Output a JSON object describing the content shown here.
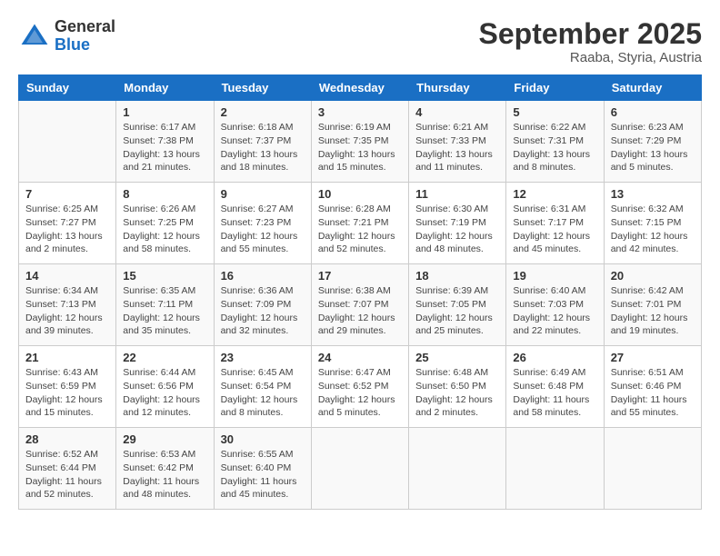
{
  "logo": {
    "general": "General",
    "blue": "Blue"
  },
  "title": {
    "month": "September 2025",
    "location": "Raaba, Styria, Austria"
  },
  "days_of_week": [
    "Sunday",
    "Monday",
    "Tuesday",
    "Wednesday",
    "Thursday",
    "Friday",
    "Saturday"
  ],
  "weeks": [
    [
      {
        "day": "",
        "info": ""
      },
      {
        "day": "1",
        "info": "Sunrise: 6:17 AM\nSunset: 7:38 PM\nDaylight: 13 hours\nand 21 minutes."
      },
      {
        "day": "2",
        "info": "Sunrise: 6:18 AM\nSunset: 7:37 PM\nDaylight: 13 hours\nand 18 minutes."
      },
      {
        "day": "3",
        "info": "Sunrise: 6:19 AM\nSunset: 7:35 PM\nDaylight: 13 hours\nand 15 minutes."
      },
      {
        "day": "4",
        "info": "Sunrise: 6:21 AM\nSunset: 7:33 PM\nDaylight: 13 hours\nand 11 minutes."
      },
      {
        "day": "5",
        "info": "Sunrise: 6:22 AM\nSunset: 7:31 PM\nDaylight: 13 hours\nand 8 minutes."
      },
      {
        "day": "6",
        "info": "Sunrise: 6:23 AM\nSunset: 7:29 PM\nDaylight: 13 hours\nand 5 minutes."
      }
    ],
    [
      {
        "day": "7",
        "info": "Sunrise: 6:25 AM\nSunset: 7:27 PM\nDaylight: 13 hours\nand 2 minutes."
      },
      {
        "day": "8",
        "info": "Sunrise: 6:26 AM\nSunset: 7:25 PM\nDaylight: 12 hours\nand 58 minutes."
      },
      {
        "day": "9",
        "info": "Sunrise: 6:27 AM\nSunset: 7:23 PM\nDaylight: 12 hours\nand 55 minutes."
      },
      {
        "day": "10",
        "info": "Sunrise: 6:28 AM\nSunset: 7:21 PM\nDaylight: 12 hours\nand 52 minutes."
      },
      {
        "day": "11",
        "info": "Sunrise: 6:30 AM\nSunset: 7:19 PM\nDaylight: 12 hours\nand 48 minutes."
      },
      {
        "day": "12",
        "info": "Sunrise: 6:31 AM\nSunset: 7:17 PM\nDaylight: 12 hours\nand 45 minutes."
      },
      {
        "day": "13",
        "info": "Sunrise: 6:32 AM\nSunset: 7:15 PM\nDaylight: 12 hours\nand 42 minutes."
      }
    ],
    [
      {
        "day": "14",
        "info": "Sunrise: 6:34 AM\nSunset: 7:13 PM\nDaylight: 12 hours\nand 39 minutes."
      },
      {
        "day": "15",
        "info": "Sunrise: 6:35 AM\nSunset: 7:11 PM\nDaylight: 12 hours\nand 35 minutes."
      },
      {
        "day": "16",
        "info": "Sunrise: 6:36 AM\nSunset: 7:09 PM\nDaylight: 12 hours\nand 32 minutes."
      },
      {
        "day": "17",
        "info": "Sunrise: 6:38 AM\nSunset: 7:07 PM\nDaylight: 12 hours\nand 29 minutes."
      },
      {
        "day": "18",
        "info": "Sunrise: 6:39 AM\nSunset: 7:05 PM\nDaylight: 12 hours\nand 25 minutes."
      },
      {
        "day": "19",
        "info": "Sunrise: 6:40 AM\nSunset: 7:03 PM\nDaylight: 12 hours\nand 22 minutes."
      },
      {
        "day": "20",
        "info": "Sunrise: 6:42 AM\nSunset: 7:01 PM\nDaylight: 12 hours\nand 19 minutes."
      }
    ],
    [
      {
        "day": "21",
        "info": "Sunrise: 6:43 AM\nSunset: 6:59 PM\nDaylight: 12 hours\nand 15 minutes."
      },
      {
        "day": "22",
        "info": "Sunrise: 6:44 AM\nSunset: 6:56 PM\nDaylight: 12 hours\nand 12 minutes."
      },
      {
        "day": "23",
        "info": "Sunrise: 6:45 AM\nSunset: 6:54 PM\nDaylight: 12 hours\nand 8 minutes."
      },
      {
        "day": "24",
        "info": "Sunrise: 6:47 AM\nSunset: 6:52 PM\nDaylight: 12 hours\nand 5 minutes."
      },
      {
        "day": "25",
        "info": "Sunrise: 6:48 AM\nSunset: 6:50 PM\nDaylight: 12 hours\nand 2 minutes."
      },
      {
        "day": "26",
        "info": "Sunrise: 6:49 AM\nSunset: 6:48 PM\nDaylight: 11 hours\nand 58 minutes."
      },
      {
        "day": "27",
        "info": "Sunrise: 6:51 AM\nSunset: 6:46 PM\nDaylight: 11 hours\nand 55 minutes."
      }
    ],
    [
      {
        "day": "28",
        "info": "Sunrise: 6:52 AM\nSunset: 6:44 PM\nDaylight: 11 hours\nand 52 minutes."
      },
      {
        "day": "29",
        "info": "Sunrise: 6:53 AM\nSunset: 6:42 PM\nDaylight: 11 hours\nand 48 minutes."
      },
      {
        "day": "30",
        "info": "Sunrise: 6:55 AM\nSunset: 6:40 PM\nDaylight: 11 hours\nand 45 minutes."
      },
      {
        "day": "",
        "info": ""
      },
      {
        "day": "",
        "info": ""
      },
      {
        "day": "",
        "info": ""
      },
      {
        "day": "",
        "info": ""
      }
    ]
  ]
}
